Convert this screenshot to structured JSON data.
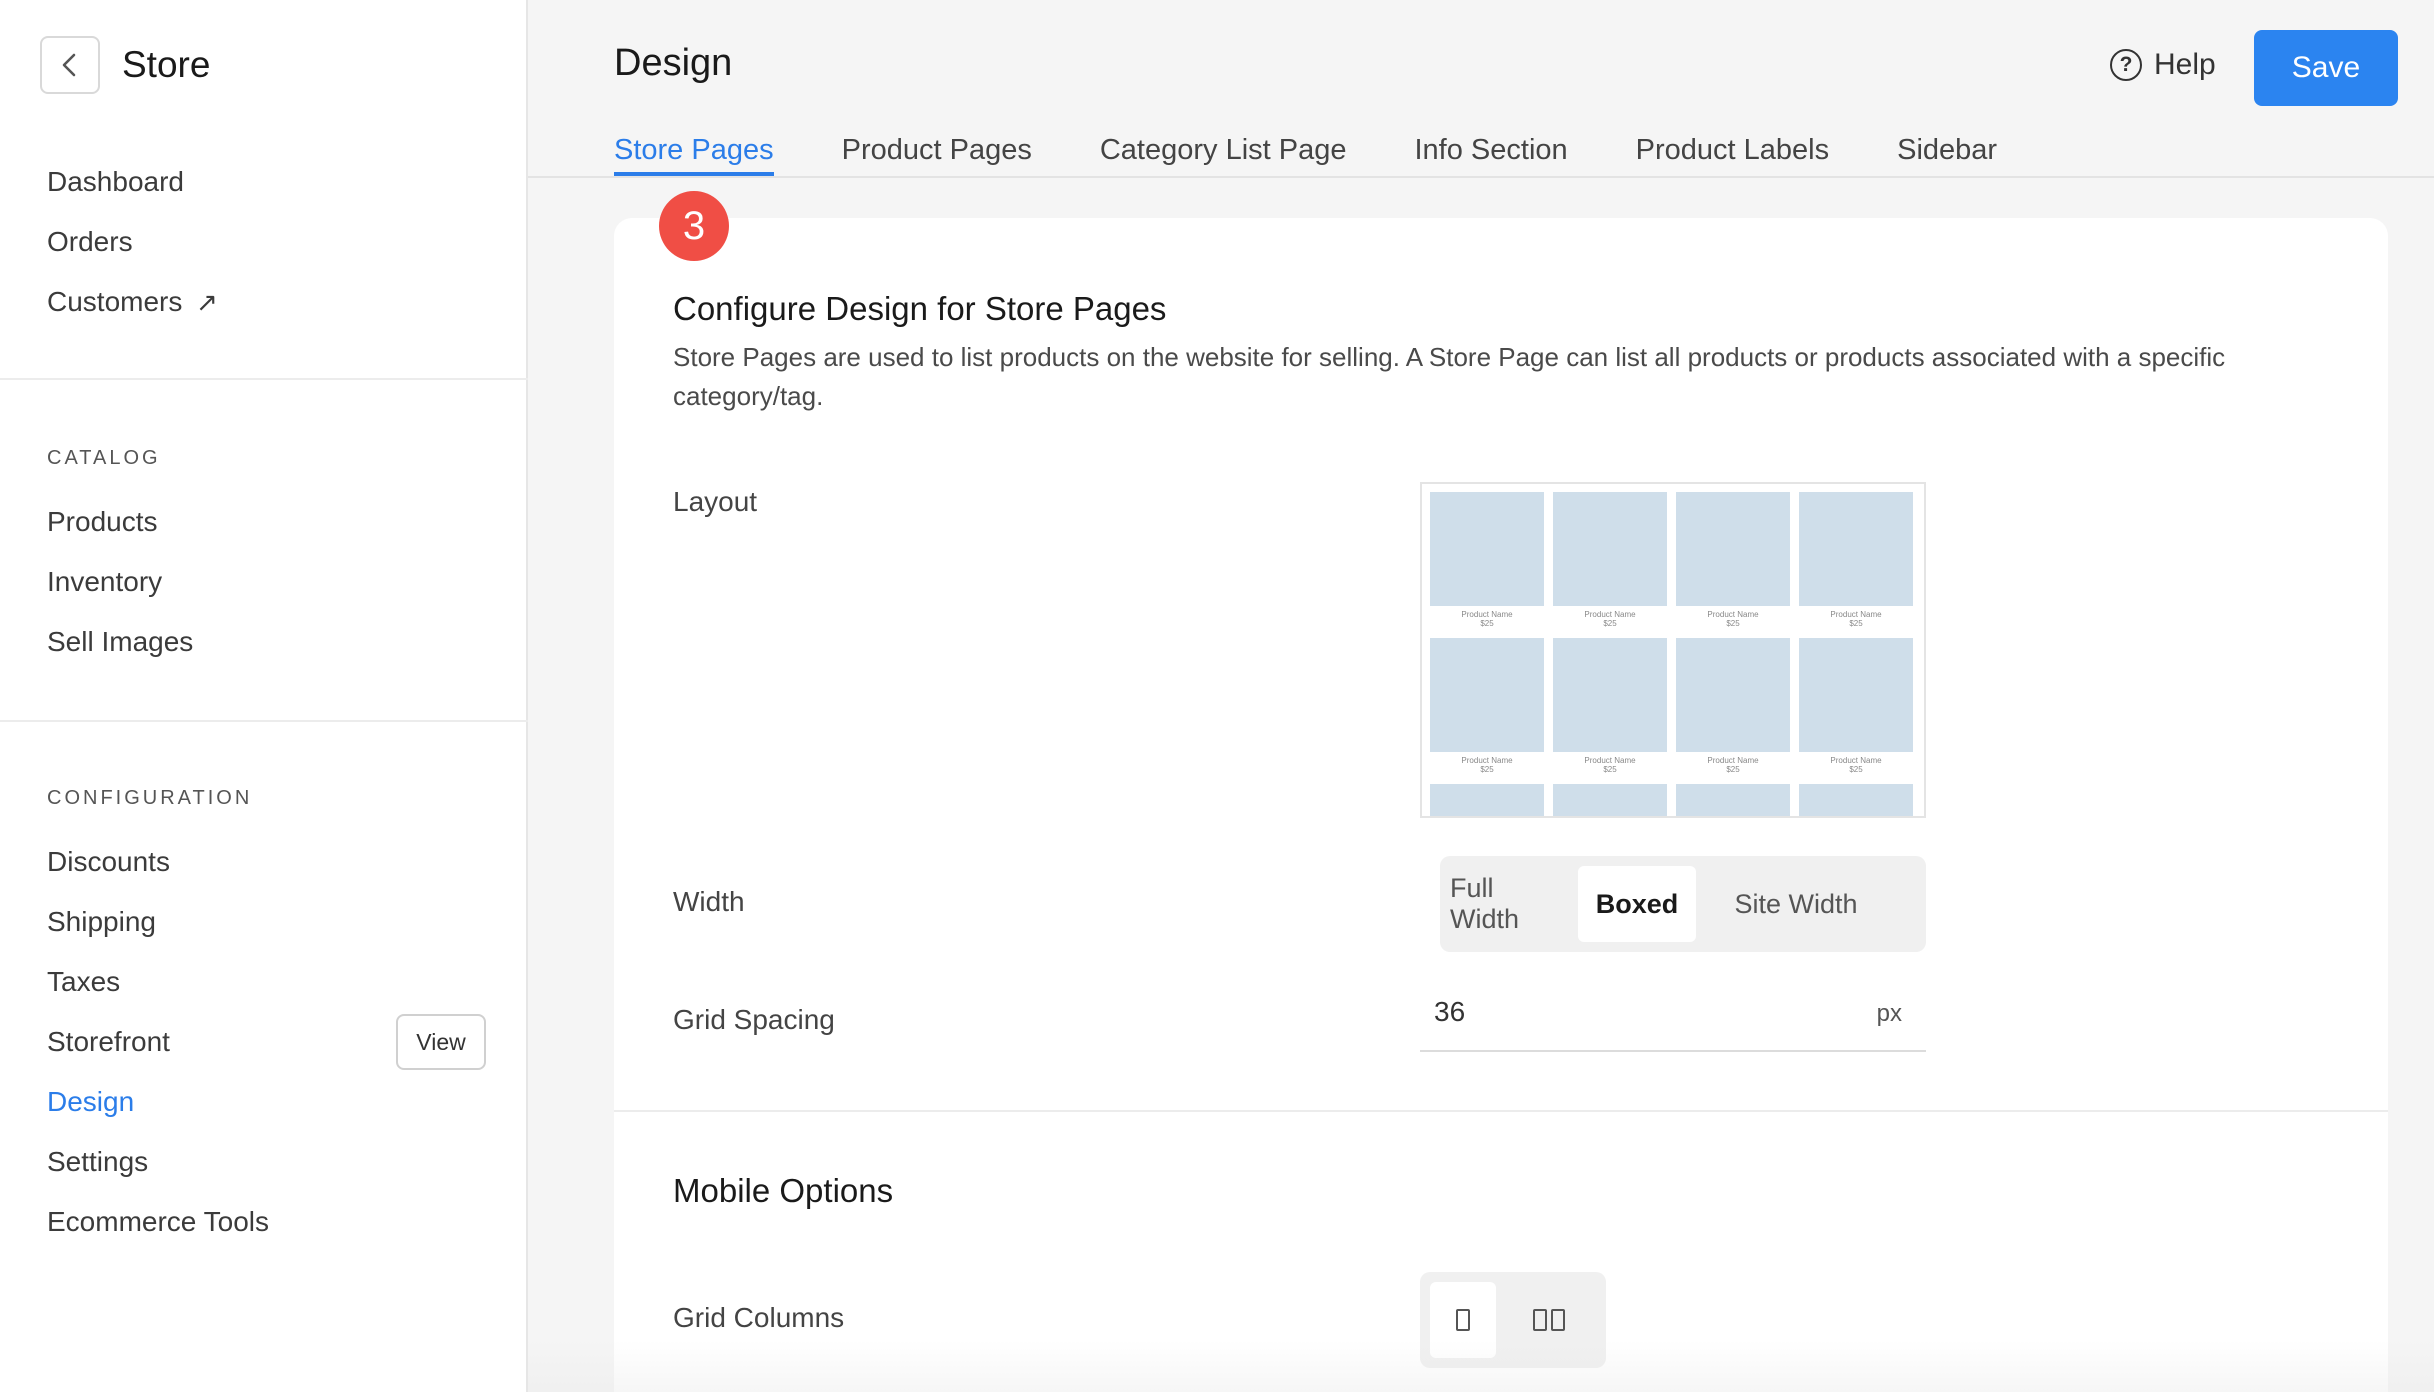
{
  "sidebar": {
    "title": "Store",
    "main_items": [
      "Dashboard",
      "Orders",
      "Customers"
    ],
    "customers_external_glyph": "↗",
    "catalog": {
      "section": "CATALOG",
      "items": [
        "Products",
        "Inventory",
        "Sell Images"
      ]
    },
    "configuration": {
      "section": "CONFIGURATION",
      "items": [
        "Discounts",
        "Shipping",
        "Taxes",
        "Storefront",
        "Design",
        "Settings",
        "Ecommerce Tools"
      ],
      "active": "Design",
      "storefront_view_label": "View"
    }
  },
  "header": {
    "title": "Design",
    "help_label": "Help",
    "save_label": "Save"
  },
  "tabs": [
    "Store Pages",
    "Product Pages",
    "Category List Page",
    "Info Section",
    "Product Labels",
    "Sidebar"
  ],
  "active_tab": "Store Pages",
  "step_badge": "3",
  "card": {
    "title": "Configure Design for Store Pages",
    "description": "Store Pages are used to list products on the website for selling. A Store Page can list all products or products associated with a specific category/tag.",
    "layout_label": "Layout",
    "layout_thumb": {
      "name": "Product Name",
      "price": "$25"
    },
    "width_label": "Width",
    "width_options": [
      "Full Width",
      "Boxed",
      "Site Width"
    ],
    "width_selected": "Boxed",
    "grid_spacing_label": "Grid Spacing",
    "grid_spacing_value": "36",
    "grid_spacing_unit": "px",
    "mobile_title": "Mobile Options",
    "grid_columns_label": "Grid Columns",
    "grid_columns_selected": 1
  },
  "colors": {
    "accent": "#2b84f0",
    "badge": "#f04e45",
    "thumb": "#cfdeea"
  }
}
